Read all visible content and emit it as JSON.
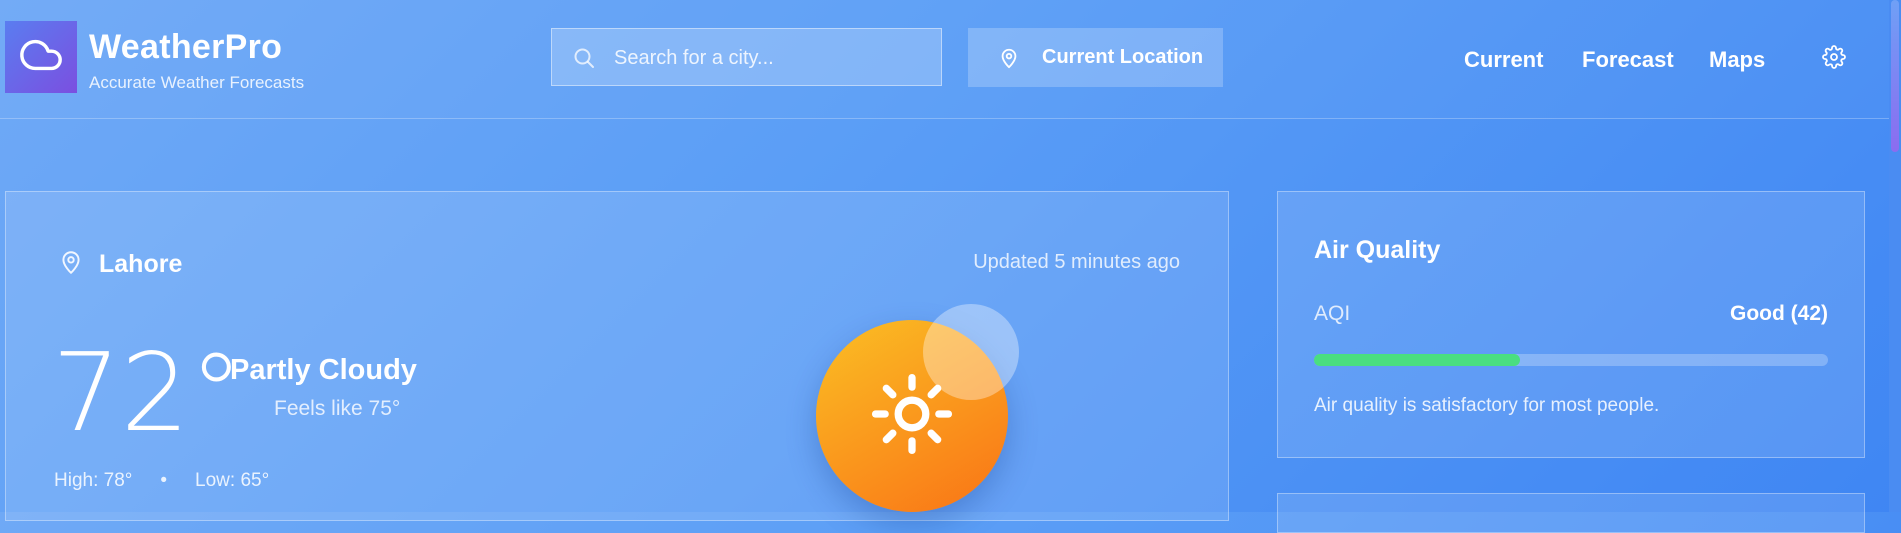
{
  "brand": {
    "name": "WeatherPro",
    "tagline": "Accurate Weather Forecasts",
    "logo_icon": "cloud-icon"
  },
  "search": {
    "placeholder": "Search for a city...",
    "value": "",
    "icon": "search-icon"
  },
  "location_button": {
    "label": "Current Location",
    "icon": "map-pin-icon"
  },
  "nav": {
    "items": [
      {
        "label": "Current"
      },
      {
        "label": "Forecast"
      },
      {
        "label": "Maps"
      }
    ],
    "settings_icon": "gear-icon"
  },
  "current": {
    "city": "Lahore",
    "updated": "Updated 5 minutes ago",
    "temperature": "72°",
    "condition": "Partly Cloudy",
    "feels_like": "Feels like 75°",
    "high": "High: 78°",
    "separator": "•",
    "low": "Low: 65°",
    "weather_icon": "sun-icon",
    "colors": {
      "sun_start": "#fbbf24",
      "sun_end": "#f97316"
    }
  },
  "air_quality": {
    "title": "Air Quality",
    "aqi_label": "AQI",
    "aqi_value": "Good (42)",
    "aqi_number": 42,
    "level_fraction": 0.4,
    "description": "Air quality is satisfactory for most people.",
    "bar_color": "#4ade80"
  },
  "colors": {
    "background_start": "#6fa9f6",
    "background_end": "#3f86f3",
    "logo_start": "#5a7df0",
    "logo_end": "#7b4fe0"
  }
}
